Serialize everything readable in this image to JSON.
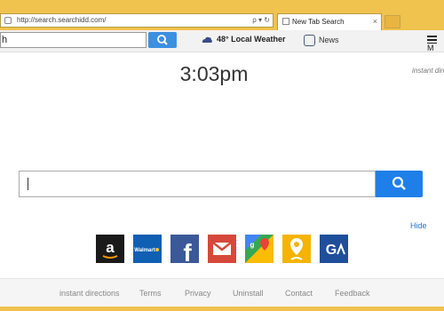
{
  "browser": {
    "url": "http://search.searchidd.com/",
    "address_controls": "ρ ▾ ↻",
    "tab_title": "New Tab Search",
    "tab_close": "×"
  },
  "toolbar": {
    "search_value": "h",
    "weather_text": "48° Local Weather",
    "news_label": "News",
    "menu_label": "M"
  },
  "main": {
    "clock": "3:03pm",
    "instant_label": "instant dire",
    "search_value": "",
    "hide_label": "Hide"
  },
  "tiles": [
    {
      "name": "amazon-icon",
      "bg": "#1a1a1a"
    },
    {
      "name": "walmart-icon",
      "bg": "#0f5fb3",
      "label": "Walmart"
    },
    {
      "name": "facebook-icon",
      "bg": "#3b5998",
      "label": "f"
    },
    {
      "name": "gmail-icon",
      "bg": "#d6493a"
    },
    {
      "name": "google-maps-icon",
      "bg": "#34a853"
    },
    {
      "name": "directions-icon",
      "bg": "#f4b400"
    },
    {
      "name": "g-logo-icon",
      "bg": "#1f4e9a",
      "label": "G"
    }
  ],
  "footer": {
    "links": [
      "instant directions",
      "Terms",
      "Privacy",
      "Uninstall",
      "Contact",
      "Feedback"
    ]
  },
  "colors": {
    "chrome": "#f0c24e",
    "search_button": "#1e7fe8",
    "link": "#2a6ec8"
  }
}
